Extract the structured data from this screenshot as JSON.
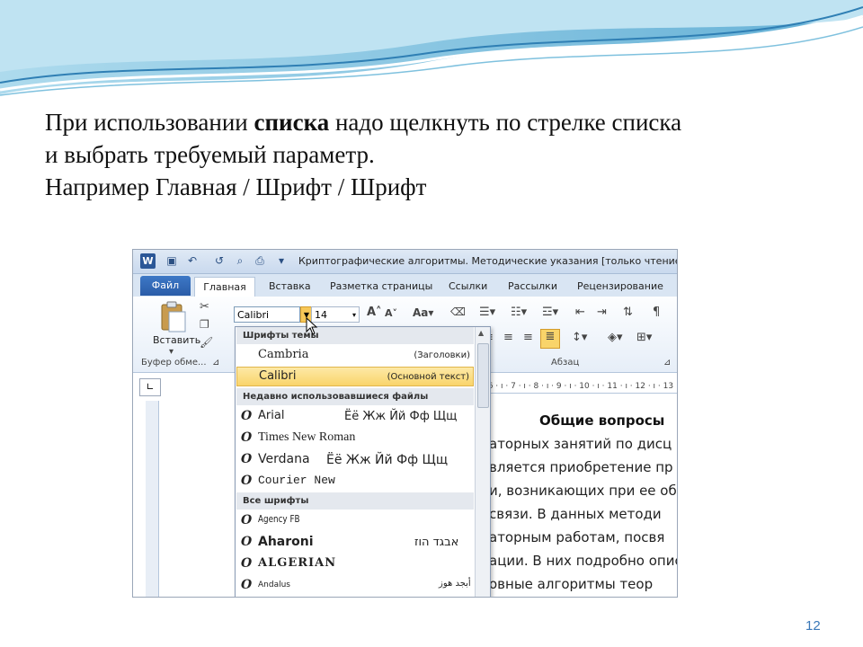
{
  "slide": {
    "line1_pre": "При использовании ",
    "line1_bold": "списка",
    "line1_post": " надо щелкнуть по стрелке списка",
    "line2": "и выбрать требуемый параметр.",
    "line3": "Например Главная / Шрифт / Шрифт",
    "page_number": "12"
  },
  "word": {
    "title": "Криптографические алгоритмы. Методические указания [только чтение] [Ре",
    "tabs": [
      "Файл",
      "Главная",
      "Вставка",
      "Разметка страницы",
      "Ссылки",
      "Рассылки",
      "Рецензирование"
    ],
    "paste_label": "Вставить",
    "clipboard_group": "Буфер обме...",
    "paragraph_group": "Абзац",
    "font_value": "Calibri",
    "size_value": "14",
    "ruler_text": "· 6 · ı · 7 · ı · 8 · ı · 9 · ı · 10 · ı · 11 · ı · 12 · ı · 13",
    "doc_heading": "Общие вопросы",
    "doc_lines": [
      "аторных занятий по дисц",
      "вляется приобретение пр",
      "и, возникающих при ее об",
      "связи. В данных методи",
      "аторным работам, посвя",
      "ации. В них подробно опис",
      "овные алгоритмы теор"
    ]
  },
  "dropdown": {
    "theme_header": "Шрифты темы",
    "theme_fonts": [
      {
        "name": "Cambria",
        "tag": "(Заголовки)"
      },
      {
        "name": "Calibri",
        "tag": "(Основной текст)"
      }
    ],
    "recent_header": "Недавно использовавшиеся файлы",
    "recent_fonts": [
      {
        "name": "Arial",
        "sample": "Ёё Жж Йй Фф Щщ"
      },
      {
        "name": "Times New Roman",
        "sample": ""
      },
      {
        "name": "Verdana",
        "sample": "Ёё Жж Йй Фф Щщ"
      },
      {
        "name": "Courier New",
        "sample": ""
      }
    ],
    "all_header": "Все шрифты",
    "all_fonts": [
      {
        "name": "Agency FB",
        "sample": ""
      },
      {
        "name": "Aharoni",
        "sample": "אבגד הוז"
      },
      {
        "name": "ALGERIAN",
        "sample": ""
      },
      {
        "name": "Andalus",
        "sample": "أبجد هوز"
      }
    ]
  }
}
